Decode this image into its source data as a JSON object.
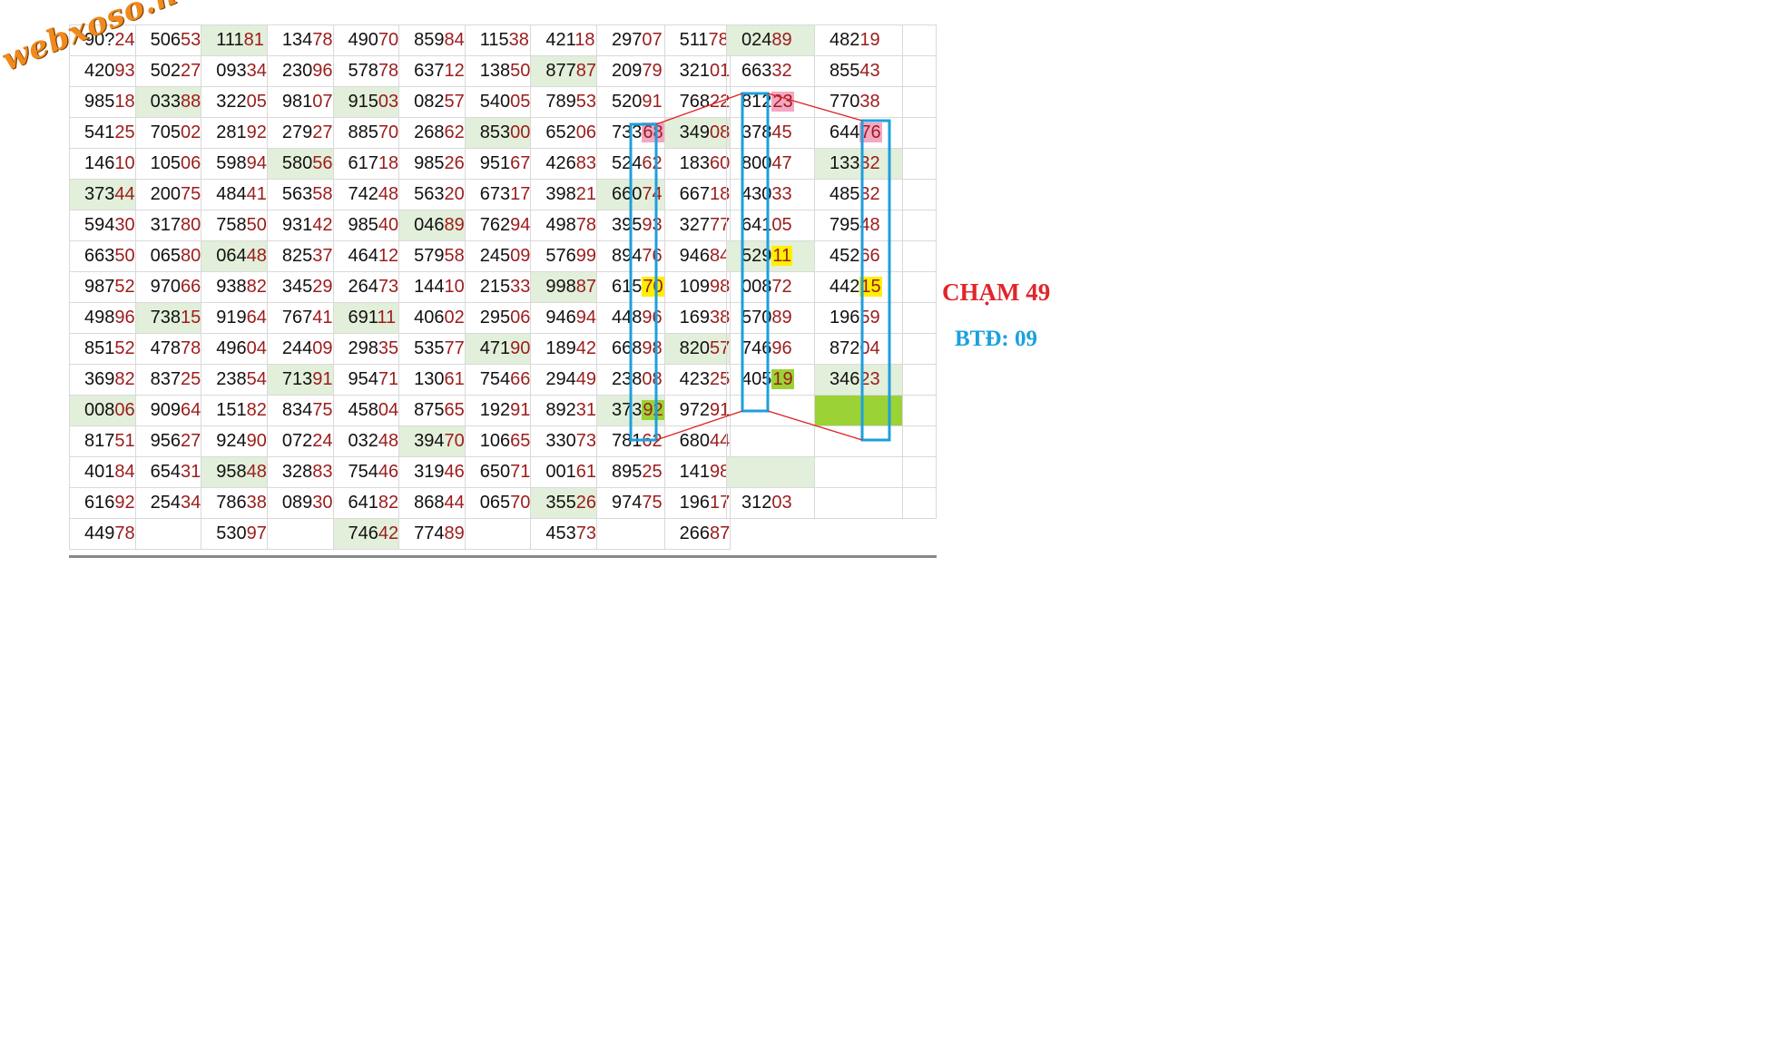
{
  "watermark": "webxoso.net",
  "annotations": {
    "cham": "CHẠM 49",
    "btd": "BTĐ: 09"
  },
  "colors": {
    "green_cell": "#e2efda",
    "tail_digits": "#9c1c1c",
    "pink_highlight": "#f4a7c3",
    "yellow_highlight": "#ffef00",
    "lime_highlight": "#9bd236",
    "box_stroke": "#1e9fdc",
    "line_stroke": "#e02020",
    "cham_text": "#e0262a",
    "btd_text": "#1aa1df"
  },
  "main_grid": [
    [
      "90?24",
      "50653",
      "11181",
      "13478",
      "49070",
      "85984",
      "11538",
      "42118",
      "29707",
      "51178"
    ],
    [
      "42093",
      "50227",
      "09334",
      "23096",
      "57878",
      "63712",
      "13850",
      "87787",
      "20979",
      "32101"
    ],
    [
      "98518",
      "03388",
      "32205",
      "98107",
      "91503",
      "08257",
      "54005",
      "78953",
      "52091",
      "76822"
    ],
    [
      "54125",
      "70502",
      "28192",
      "27927",
      "88570",
      "26862",
      "85300",
      "65206",
      "73368",
      "34908"
    ],
    [
      "14610",
      "10506",
      "59894",
      "58056",
      "61718",
      "98526",
      "95167",
      "42683",
      "52462",
      "18360"
    ],
    [
      "37344",
      "20075",
      "48441",
      "56358",
      "74248",
      "56320",
      "67317",
      "39821",
      "66074",
      "66718"
    ],
    [
      "59430",
      "31780",
      "75850",
      "93142",
      "98540",
      "04689",
      "76294",
      "49878",
      "39593",
      "32777"
    ],
    [
      "66350",
      "06580",
      "06448",
      "82537",
      "46412",
      "57958",
      "24509",
      "57699",
      "89476",
      "94684"
    ],
    [
      "98752",
      "97066",
      "93882",
      "34529",
      "26473",
      "14410",
      "21533",
      "99887",
      "61570",
      "10998"
    ],
    [
      "49896",
      "73815",
      "91964",
      "76741",
      "69111",
      "40602",
      "29506",
      "94694",
      "44896",
      "16938"
    ],
    [
      "85152",
      "47878",
      "49604",
      "24409",
      "29835",
      "53577",
      "47190",
      "18942",
      "66898",
      "82057"
    ],
    [
      "36982",
      "83725",
      "23854",
      "71391",
      "95471",
      "13061",
      "75466",
      "29449",
      "23808",
      "42325"
    ],
    [
      "00806",
      "90964",
      "15182",
      "83475",
      "45804",
      "87565",
      "19291",
      "89231",
      "37392",
      "97291"
    ],
    [
      "81751",
      "95627",
      "92490",
      "07224",
      "03248",
      "39470",
      "10665",
      "33073",
      "78162",
      "68044"
    ],
    [
      "40184",
      "65431",
      "95848",
      "32883",
      "75446",
      "31946",
      "65071",
      "00161",
      "89525",
      "14198"
    ],
    [
      "61692",
      "25434",
      "78638",
      "08930",
      "64182",
      "86844",
      "06570",
      "35526",
      "97475",
      "19617"
    ],
    [
      "44978",
      "",
      "53097",
      "",
      "74642",
      "77489",
      "",
      "45373",
      "",
      "26687"
    ]
  ],
  "right_grid": [
    [
      "02489",
      "48219"
    ],
    [
      "66332",
      "85543"
    ],
    [
      "81223",
      "77038"
    ],
    [
      "37845",
      "64476"
    ],
    [
      "80047",
      "13332"
    ],
    [
      "43033",
      "48532"
    ],
    [
      "64105",
      "79548"
    ],
    [
      "52911",
      "45266"
    ],
    [
      "00872",
      "44215"
    ],
    [
      "57089",
      "19659"
    ],
    [
      "74696",
      "87204"
    ],
    [
      "40519",
      "34623"
    ],
    [
      "",
      ""
    ],
    [
      "",
      ""
    ],
    [
      "",
      ""
    ],
    [
      "31203",
      ""
    ]
  ]
}
